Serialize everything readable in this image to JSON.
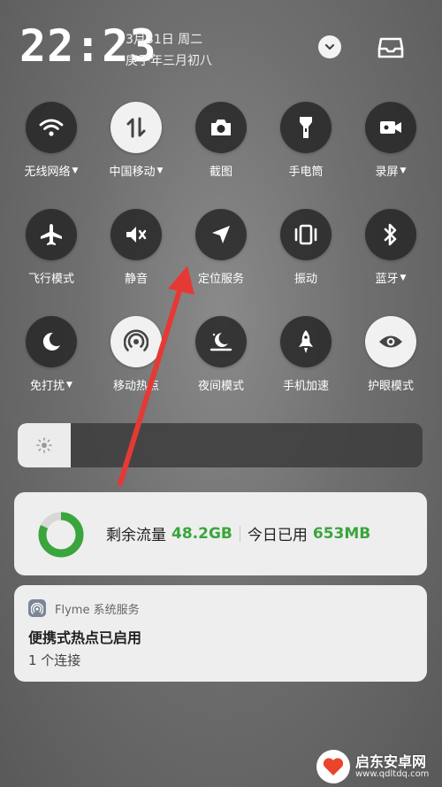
{
  "status": {
    "time": "22:23",
    "date_line1": "3月31日 周二",
    "date_line2": "庚子年三月初八"
  },
  "icons": {
    "collapse": "chevron-down-icon",
    "inbox": "inbox-icon"
  },
  "toggles": [
    {
      "id": "wifi",
      "label": "无线网络",
      "icon": "wifi-icon",
      "dropdown": true,
      "on": false
    },
    {
      "id": "mobile-data",
      "label": "中国移动",
      "icon": "mobile-data-icon",
      "dropdown": true,
      "on": true
    },
    {
      "id": "screenshot",
      "label": "截图",
      "icon": "camera-icon",
      "dropdown": false,
      "on": false
    },
    {
      "id": "flashlight",
      "label": "手电筒",
      "icon": "flashlight-icon",
      "dropdown": false,
      "on": false
    },
    {
      "id": "screen-record",
      "label": "录屏",
      "icon": "video-camera-icon",
      "dropdown": true,
      "on": false
    },
    {
      "id": "airplane",
      "label": "飞行模式",
      "icon": "airplane-icon",
      "dropdown": false,
      "on": false
    },
    {
      "id": "mute",
      "label": "静音",
      "icon": "mute-icon",
      "dropdown": false,
      "on": false
    },
    {
      "id": "location",
      "label": "定位服务",
      "icon": "location-arrow-icon",
      "dropdown": false,
      "on": false
    },
    {
      "id": "vibrate",
      "label": "振动",
      "icon": "vibrate-icon",
      "dropdown": false,
      "on": false
    },
    {
      "id": "bluetooth",
      "label": "蓝牙",
      "icon": "bluetooth-icon",
      "dropdown": true,
      "on": false
    },
    {
      "id": "dnd",
      "label": "免打扰",
      "icon": "moon-icon",
      "dropdown": true,
      "on": false
    },
    {
      "id": "hotspot",
      "label": "移动热点",
      "icon": "hotspot-icon",
      "dropdown": false,
      "on": true
    },
    {
      "id": "night-mode",
      "label": "夜间模式",
      "icon": "night-mode-icon",
      "dropdown": false,
      "on": false
    },
    {
      "id": "boost",
      "label": "手机加速",
      "icon": "rocket-icon",
      "dropdown": false,
      "on": false
    },
    {
      "id": "eye-care",
      "label": "护眼模式",
      "icon": "eye-icon",
      "dropdown": false,
      "on": true
    }
  ],
  "brightness": {
    "level": 0.13,
    "icon": "sun-icon"
  },
  "data_usage": {
    "remaining_label": "剩余流量",
    "remaining_value": "48.2GB",
    "today_label": "今日已用",
    "today_value": "653MB",
    "ring_fraction": 0.82,
    "accent": "#3aa53c"
  },
  "notification": {
    "app_name": "Flyme 系统服务",
    "title": "便携式热点已启用",
    "body": "1 个连接"
  },
  "watermark": {
    "name": "启东安卓网",
    "url": "www.qdltdq.com"
  },
  "colors": {
    "arrow": "#e53935"
  }
}
